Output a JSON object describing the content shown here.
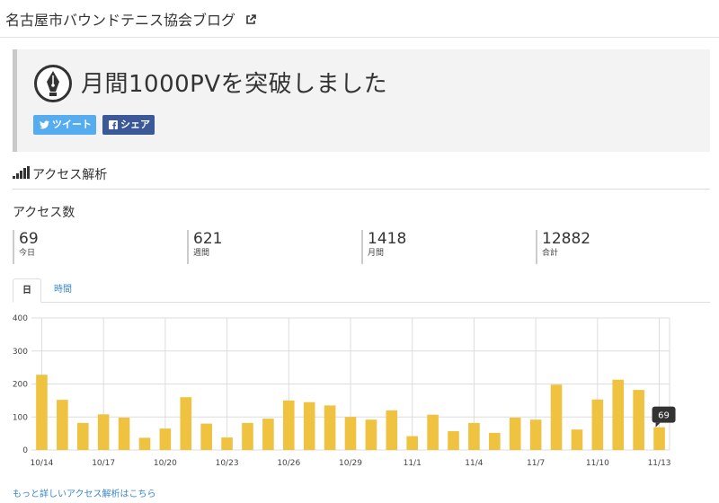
{
  "blog": {
    "title": "名古屋市バウンドテニス協会ブログ",
    "icon": "external-link-icon"
  },
  "entry": {
    "title": "月間1000PVを突破しました",
    "icon": "pen-nib-icon"
  },
  "share": {
    "tweet_label": "ツイート",
    "share_label": "シェア",
    "tweet_color": "#55acee",
    "share_color": "#3b5998"
  },
  "analytics": {
    "section_title": "アクセス解析",
    "access_label": "アクセス数",
    "stats": [
      {
        "value": "69",
        "label": "今日"
      },
      {
        "value": "621",
        "label": "週間"
      },
      {
        "value": "1418",
        "label": "月間"
      },
      {
        "value": "12882",
        "label": "合計"
      }
    ],
    "tabs": [
      {
        "label": "日",
        "active": true
      },
      {
        "label": "時間",
        "active": false
      }
    ],
    "more_link": "もっと詳しいアクセス解析はこちら"
  },
  "chart_data": {
    "type": "bar",
    "bar_color": "#efc240",
    "ylim": [
      0,
      400
    ],
    "yticks": [
      0,
      100,
      200,
      300,
      400
    ],
    "x_tick_labels": [
      "10/14",
      "10/17",
      "10/20",
      "10/23",
      "10/26",
      "10/29",
      "11/1",
      "11/4",
      "11/7",
      "11/10",
      "11/13"
    ],
    "categories": [
      "10/14",
      "10/15",
      "10/16",
      "10/17",
      "10/18",
      "10/19",
      "10/20",
      "10/21",
      "10/22",
      "10/23",
      "10/24",
      "10/25",
      "10/26",
      "10/27",
      "10/28",
      "10/29",
      "10/30",
      "10/31",
      "11/1",
      "11/2",
      "11/3",
      "11/4",
      "11/5",
      "11/6",
      "11/7",
      "11/8",
      "11/9",
      "11/10",
      "11/11",
      "11/12",
      "11/13"
    ],
    "values": [
      228,
      152,
      82,
      108,
      98,
      37,
      65,
      160,
      80,
      38,
      82,
      95,
      150,
      145,
      135,
      100,
      92,
      120,
      42,
      107,
      57,
      82,
      52,
      98,
      92,
      198,
      62,
      153,
      213,
      182,
      69
    ],
    "tooltip": "69"
  }
}
